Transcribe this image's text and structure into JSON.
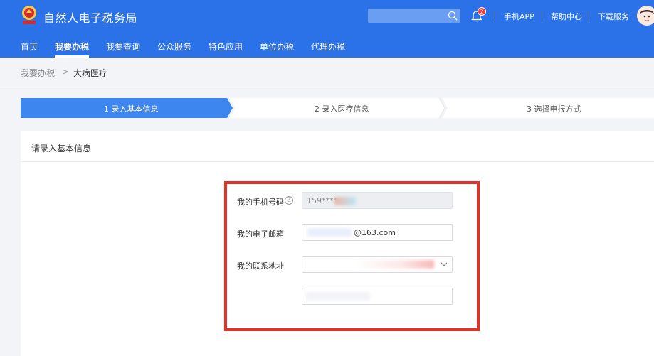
{
  "header": {
    "site_title": "自然人电子税务局",
    "notification_count": "2",
    "links": [
      "手机APP",
      "帮助中心",
      "下载服务"
    ]
  },
  "nav": {
    "items": [
      "首页",
      "我要办税",
      "我要查询",
      "公众服务",
      "特色应用",
      "单位办税",
      "代理办税"
    ],
    "active_index": 1
  },
  "breadcrumb": {
    "parent": "我要办税",
    "separator": ">",
    "current": "大病医疗"
  },
  "steps": [
    {
      "label": "1 录入基本信息",
      "state": "active"
    },
    {
      "label": "2 录入医疗信息",
      "state": "pending"
    },
    {
      "label": "3 选择申报方式",
      "state": "pending"
    }
  ],
  "form": {
    "title": "请录入基本信息",
    "phone_label": "我的手机号码",
    "phone_value": "159****",
    "email_label": "我的电子邮箱",
    "email_value": "@163.com",
    "address_label": "我的联系地址",
    "address_value": "",
    "address_detail_value": ""
  },
  "colors": {
    "brand": "#2b71e8",
    "highlight_box": "#e8302a"
  }
}
